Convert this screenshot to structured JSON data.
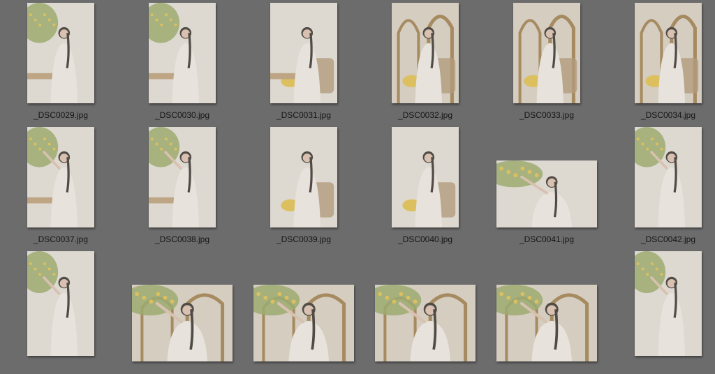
{
  "window": {
    "background": "#6c6c6c"
  },
  "files": [
    {
      "name": "_DSC0029.jpg",
      "orientation": "portrait",
      "scene": "tree-left"
    },
    {
      "name": "_DSC0030.jpg",
      "orientation": "portrait",
      "scene": "tree-left"
    },
    {
      "name": "_DSC0031.jpg",
      "orientation": "portrait",
      "scene": "seated-table"
    },
    {
      "name": "_DSC0032.jpg",
      "orientation": "portrait",
      "scene": "arch-chair"
    },
    {
      "name": "_DSC0033.jpg",
      "orientation": "portrait",
      "scene": "arch-chair"
    },
    {
      "name": "_DSC0034.jpg",
      "orientation": "portrait",
      "scene": "arch-chair"
    },
    {
      "name": "_DSC0037.jpg",
      "orientation": "portrait",
      "scene": "reaching"
    },
    {
      "name": "_DSC0038.jpg",
      "orientation": "portrait",
      "scene": "reaching"
    },
    {
      "name": "_DSC0039.jpg",
      "orientation": "portrait",
      "scene": "seated-basket"
    },
    {
      "name": "_DSC0040.jpg",
      "orientation": "portrait",
      "scene": "seated-basket"
    },
    {
      "name": "_DSC0041.jpg",
      "orientation": "landscape",
      "scene": "lemon-tree-wide"
    },
    {
      "name": "_DSC0042.jpg",
      "orientation": "portrait",
      "scene": "lemon-tree-tall"
    },
    {
      "name": "",
      "orientation": "portrait",
      "scene": "lemon-tree-tall"
    },
    {
      "name": "",
      "orientation": "landscape",
      "scene": "arch-wide"
    },
    {
      "name": "",
      "orientation": "landscape",
      "scene": "arch-wide"
    },
    {
      "name": "",
      "orientation": "landscape",
      "scene": "arch-wide"
    },
    {
      "name": "",
      "orientation": "landscape",
      "scene": "arch-wide"
    },
    {
      "name": "",
      "orientation": "portrait",
      "scene": "lemon-tree-tall"
    }
  ]
}
